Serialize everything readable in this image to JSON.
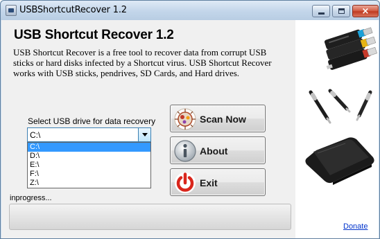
{
  "window": {
    "title": "USBShortcutRecover 1.2",
    "controls": {
      "minimize": "minimize",
      "maximize": "maximize",
      "close": "×"
    }
  },
  "main": {
    "heading": "USB Shortcut Recover 1.2",
    "description": "USB Shortcut Recover is a free tool to recover data from corrupt USB sticks or hard disks infected by a Shortcut virus. USB Shortcut Recover works with USB sticks, pendrives, SD Cards, and Hard drives."
  },
  "drive_select": {
    "label": "Select USB drive for data recovery",
    "selected_value": "C:\\",
    "options": [
      "C:\\",
      "D:\\",
      "E:\\",
      "F:\\",
      "Z:\\"
    ],
    "highlighted_index": 0
  },
  "buttons": {
    "scan": {
      "label": "Scan Now",
      "icon": "virus-scan-icon"
    },
    "about": {
      "label": "About",
      "icon": "info-icon"
    },
    "exit": {
      "label": "Exit",
      "icon": "power-icon"
    }
  },
  "status": {
    "text": "inprogress...",
    "progress": 0
  },
  "side_images": [
    "usb-flash-drives-image",
    "usb-pen-drives-image",
    "external-hard-drive-image"
  ],
  "links": {
    "donate": "Donate"
  },
  "colors": {
    "titlebar": "#c3d6ea",
    "client_bg": "#f0f0f0",
    "selection": "#3399ff",
    "link": "#0033cc",
    "exit_icon": "#d9261c"
  }
}
